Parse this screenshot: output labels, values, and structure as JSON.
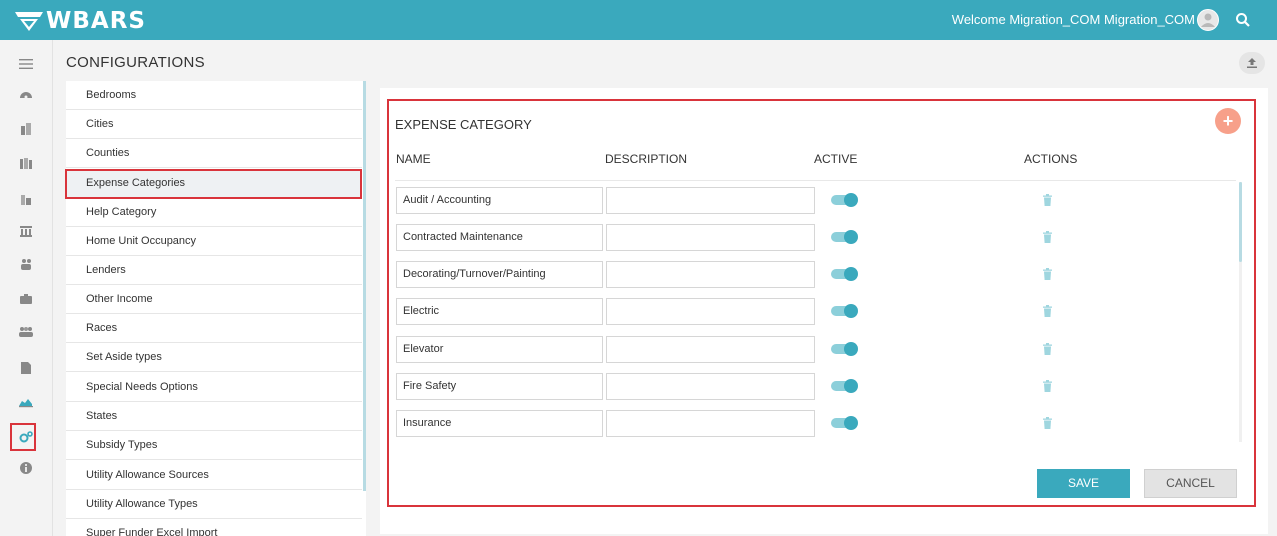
{
  "app": {
    "brand": "WBARS",
    "welcome": "Welcome Migration_COM Migration_COM"
  },
  "page": {
    "title": "CONFIGURATIONS"
  },
  "rail": {
    "icons": [
      "menu-icon",
      "dashboard-icon",
      "building-icon",
      "buildings-icon",
      "city-icon",
      "bank-icon",
      "people-icon",
      "briefcase-icon",
      "group-icon",
      "document-icon",
      "chart-icon",
      "configuration-icon",
      "info-icon"
    ],
    "active": "configuration-icon"
  },
  "config_list": {
    "items": [
      "Bedrooms",
      "Cities",
      "Counties",
      "Expense Categories",
      "Help Category",
      "Home Unit Occupancy",
      "Lenders",
      "Other Income",
      "Races",
      "Set Aside types",
      "Special Needs Options",
      "States",
      "Subsidy Types",
      "Utility Allowance Sources",
      "Utility Allowance Types",
      "Super Funder Excel Import"
    ],
    "selected": "Expense Categories"
  },
  "expense": {
    "title": "EXPENSE CATEGORY",
    "add_label": "+",
    "columns": {
      "name": "NAME",
      "description": "DESCRIPTION",
      "active": "ACTIVE",
      "actions": "ACTIONS"
    },
    "rows": [
      {
        "name": "Audit / Accounting",
        "description": "",
        "active": true
      },
      {
        "name": "Contracted Maintenance",
        "description": "",
        "active": true
      },
      {
        "name": "Decorating/Turnover/Painting",
        "description": "",
        "active": true
      },
      {
        "name": "Electric",
        "description": "",
        "active": true
      },
      {
        "name": "Elevator",
        "description": "",
        "active": true
      },
      {
        "name": "Fire Safety",
        "description": "",
        "active": true
      },
      {
        "name": "Insurance",
        "description": "",
        "active": true
      }
    ],
    "save_label": "SAVE",
    "cancel_label": "CANCEL"
  },
  "colors": {
    "accent": "#3aa9bd",
    "highlight": "#d9343b",
    "add_button": "#f7a08a"
  }
}
